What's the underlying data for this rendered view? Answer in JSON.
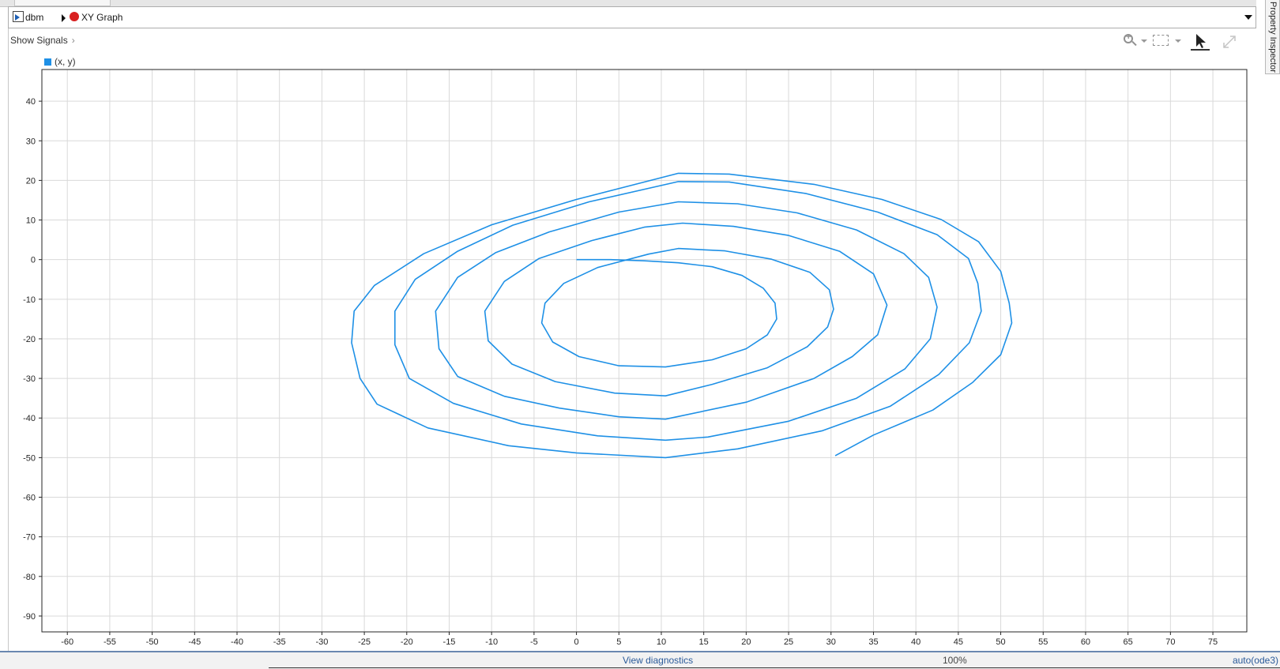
{
  "breadcrumb": {
    "model": "dbm",
    "block": "XY Graph"
  },
  "show_signals_label": "Show Signals",
  "legend": {
    "label": "(x, y)",
    "color": "#1e90e6"
  },
  "toolbar": {
    "icons": [
      "zoom-icon",
      "fit-to-view-icon",
      "cursor-icon",
      "expand-icon"
    ]
  },
  "status": {
    "diagnostics": "View diagnostics",
    "zoom": "100%",
    "solver": "auto(ode3)"
  },
  "side_panel": "Property Inspector",
  "chart_data": {
    "type": "line",
    "title": "",
    "xlabel": "",
    "ylabel": "",
    "xlim": [
      -63,
      79
    ],
    "ylim": [
      -94,
      48
    ],
    "xticks": [
      -60,
      -55,
      -50,
      -45,
      -40,
      -35,
      -30,
      -25,
      -20,
      -15,
      -10,
      -5,
      0,
      5,
      10,
      15,
      20,
      25,
      30,
      35,
      40,
      45,
      50,
      55,
      60,
      65,
      70,
      75
    ],
    "yticks": [
      40,
      30,
      20,
      10,
      0,
      -10,
      -20,
      -30,
      -40,
      -50,
      -60,
      -70,
      -80,
      -90
    ],
    "grid": true,
    "series": [
      {
        "name": "(x, y)",
        "color": "#1e90e6",
        "points": [
          [
            0,
            0
          ],
          [
            4,
            0
          ],
          [
            8,
            -0.3
          ],
          [
            12,
            -0.8
          ],
          [
            16,
            -1.8
          ],
          [
            19.5,
            -4
          ],
          [
            22,
            -7.2
          ],
          [
            23.4,
            -11
          ],
          [
            23.6,
            -15
          ],
          [
            22.5,
            -19
          ],
          [
            20,
            -22.5
          ],
          [
            16,
            -25.3
          ],
          [
            10.5,
            -27.1
          ],
          [
            5,
            -26.8
          ],
          [
            0.3,
            -24.5
          ],
          [
            -2.8,
            -20.8
          ],
          [
            -4.1,
            -16
          ],
          [
            -3.7,
            -11
          ],
          [
            -1.5,
            -6
          ],
          [
            2.5,
            -2
          ],
          [
            8.5,
            1.4
          ],
          [
            12,
            2.8
          ],
          [
            17.5,
            2.2
          ],
          [
            23,
            0.1
          ],
          [
            27.5,
            -3.2
          ],
          [
            29.8,
            -7.6
          ],
          [
            30.3,
            -12.5
          ],
          [
            29.6,
            -17
          ],
          [
            27.2,
            -22
          ],
          [
            22.5,
            -27.3
          ],
          [
            16,
            -31.5
          ],
          [
            10.5,
            -34.4
          ],
          [
            4.5,
            -33.7
          ],
          [
            -2.5,
            -30.8
          ],
          [
            -7.6,
            -26.4
          ],
          [
            -10.4,
            -20.5
          ],
          [
            -10.8,
            -13
          ],
          [
            -8.5,
            -5.5
          ],
          [
            -4.4,
            0.3
          ],
          [
            1.8,
            4.8
          ],
          [
            8,
            8.2
          ],
          [
            12.5,
            9.2
          ],
          [
            18.5,
            8.4
          ],
          [
            25,
            6.1
          ],
          [
            31,
            2.1
          ],
          [
            35,
            -3.6
          ],
          [
            36.6,
            -11.5
          ],
          [
            35.5,
            -19
          ],
          [
            32.5,
            -24.5
          ],
          [
            28,
            -30
          ],
          [
            20,
            -36
          ],
          [
            10.5,
            -40.3
          ],
          [
            5,
            -39.7
          ],
          [
            -2,
            -37.5
          ],
          [
            -8.5,
            -34.5
          ],
          [
            -14,
            -29.5
          ],
          [
            -16.2,
            -22.5
          ],
          [
            -16.6,
            -13
          ],
          [
            -14,
            -4.5
          ],
          [
            -9.5,
            1.8
          ],
          [
            -3.2,
            7
          ],
          [
            5,
            12
          ],
          [
            12,
            14.6
          ],
          [
            19,
            14.1
          ],
          [
            26,
            11.8
          ],
          [
            33,
            7.5
          ],
          [
            38.6,
            1.5
          ],
          [
            41.5,
            -4.5
          ],
          [
            42.5,
            -12
          ],
          [
            41.7,
            -20
          ],
          [
            38.7,
            -27.6
          ],
          [
            33,
            -35
          ],
          [
            25,
            -40.8
          ],
          [
            15.5,
            -44.8
          ],
          [
            10.5,
            -45.6
          ],
          [
            2.5,
            -44.5
          ],
          [
            -6.5,
            -41.5
          ],
          [
            -14.5,
            -36.3
          ],
          [
            -19.7,
            -30
          ],
          [
            -21.4,
            -21.5
          ],
          [
            -21.4,
            -13
          ],
          [
            -19,
            -5
          ],
          [
            -14,
            2.1
          ],
          [
            -7.5,
            8.7
          ],
          [
            1.5,
            14.6
          ],
          [
            12,
            19.7
          ],
          [
            18,
            19.6
          ],
          [
            27,
            16.7
          ],
          [
            35.5,
            12
          ],
          [
            42.5,
            6.3
          ],
          [
            46.2,
            0.3
          ],
          [
            47.3,
            -6
          ],
          [
            47.7,
            -13
          ],
          [
            46.3,
            -21
          ],
          [
            42.7,
            -29
          ],
          [
            37,
            -37
          ],
          [
            29,
            -43.2
          ],
          [
            19,
            -47.8
          ],
          [
            10.5,
            -50
          ],
          [
            0,
            -48.8
          ],
          [
            -8,
            -47
          ],
          [
            -17.5,
            -42.5
          ],
          [
            -23.5,
            -36.5
          ],
          [
            -25.5,
            -30
          ],
          [
            -26.5,
            -21
          ],
          [
            -26.2,
            -13
          ],
          [
            -23.8,
            -6.5
          ],
          [
            -18,
            1.5
          ],
          [
            -10,
            8.8
          ],
          [
            0,
            15.2
          ],
          [
            12,
            21.8
          ],
          [
            18,
            21.6
          ],
          [
            28,
            19
          ],
          [
            36,
            15.2
          ],
          [
            43,
            10.1
          ],
          [
            47.4,
            4.5
          ],
          [
            50,
            -3
          ],
          [
            51,
            -11
          ],
          [
            51.3,
            -16
          ],
          [
            50,
            -24
          ],
          [
            46.7,
            -31
          ],
          [
            42,
            -38
          ],
          [
            35,
            -44.3
          ],
          [
            30.5,
            -49.5
          ]
        ]
      }
    ]
  }
}
